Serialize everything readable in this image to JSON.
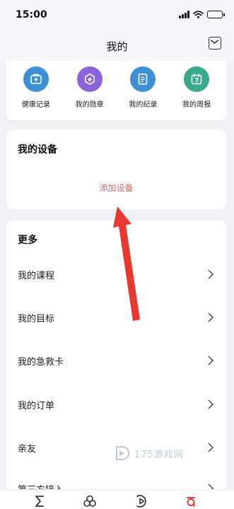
{
  "status_bar": {
    "time": "15:00"
  },
  "header": {
    "title": "我的",
    "mail_icon": "mail-icon"
  },
  "shortcuts": [
    {
      "label": "健康记录",
      "icon": "medical-box-icon",
      "color": "#3d8fd6"
    },
    {
      "label": "我的勋章",
      "icon": "medal-icon",
      "color": "#8a63d8"
    },
    {
      "label": "我的纪录",
      "icon": "document-icon",
      "color": "#3d8fd6"
    },
    {
      "label": "我的周报",
      "icon": "calendar-icon",
      "color": "#3aa98a"
    }
  ],
  "device_section": {
    "title": "我的设备",
    "add_label": "添加设备",
    "accent": "#cf6a6a"
  },
  "more_section": {
    "title": "更多",
    "items": [
      {
        "label": "我的课程"
      },
      {
        "label": "我的目标"
      },
      {
        "label": "我的急救卡"
      },
      {
        "label": "我的订单"
      },
      {
        "label": "亲友"
      },
      {
        "label": "第三方接入"
      }
    ]
  },
  "watermark": {
    "text": "175游戏网"
  },
  "tab_bar": {
    "tabs": [
      {
        "icon": "sigma-icon"
      },
      {
        "icon": "community-icon"
      },
      {
        "icon": "play-icon"
      },
      {
        "icon": "profile-icon",
        "active": true,
        "color": "#e0443a"
      }
    ]
  },
  "annotation": {
    "arrow_color": "#e8382f"
  }
}
